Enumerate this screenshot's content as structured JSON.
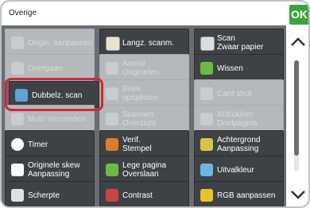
{
  "header": {
    "title": "Overige",
    "ok_label": "OK"
  },
  "buttons": {
    "r1c1": "Origin. aanpassen",
    "r1c2": "Langz. scanm.",
    "r1c3": "Scan\nZwaar papier",
    "r2c1": "Overgaan",
    "r2c2": "Aantal\nOriginelen",
    "r2c3": "Wissen",
    "r3c1": "Dubbelz. scan",
    "r3c2": "Boek\nopsplitsen",
    "r3c3": "Card shot",
    "r4c1": "Multi-Verzenden",
    "r4c2": "Scannen\nOverzicht",
    "r4c3": "Afdrukken\nDoelpagina",
    "r5c1": "Timer",
    "r5c2": "Verif.\nStempel",
    "r5c3": "Achtergrond\nAanpassing",
    "r6c1": "Originele skew\nAanpassing",
    "r6c2": "Lege pagina\nOverslaan",
    "r6c3": "Uitvalkleur",
    "r7c1": "Scherpte",
    "r7c2": "Contrast",
    "r7c3": "RGB aanpassen"
  },
  "colors": {
    "ok": "#3aa43a",
    "highlight": "#d6263b",
    "button": "#3e4245",
    "disabled": "#b6b9bc"
  },
  "icons": {
    "r1c2": "scan-doc-icon",
    "r1c3": "scan-paper-icon",
    "r2c3": "eraser-icon",
    "r3c1": "duplex-scan-icon",
    "r5c1": "timer-icon",
    "r5c2": "stamp-icon",
    "r5c3": "background-adjust-icon",
    "r6c1": "skew-adjust-icon",
    "r6c2": "blank-page-icon",
    "r6c3": "color-dropout-icon",
    "r7c1": "sharpness-icon",
    "r7c2": "contrast-icon",
    "r7c3": "rgb-adjust-icon"
  }
}
